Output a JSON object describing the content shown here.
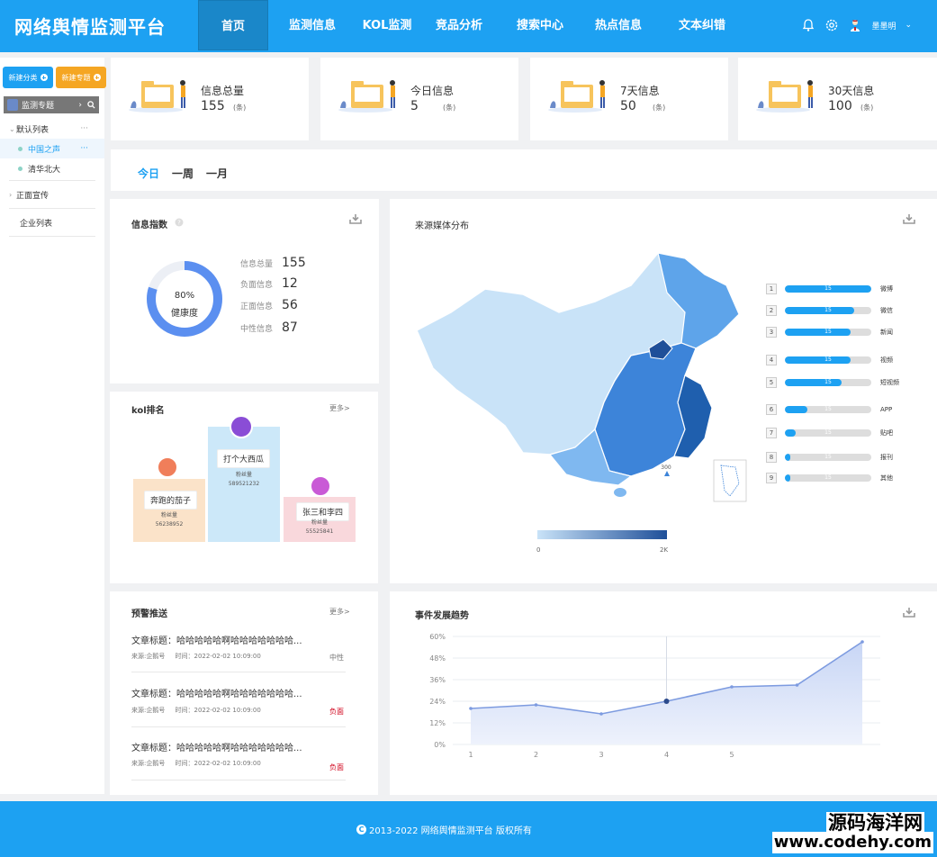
{
  "header": {
    "title": "网络舆情监测平台",
    "nav": [
      "首页",
      "监测信息",
      "KOL监测",
      "竞品分析",
      "搜索中心",
      "热点信息",
      "文本纠错"
    ],
    "active_nav": 0,
    "username": "墨墨明"
  },
  "sidebar": {
    "new_category": "新建分类",
    "new_topic": "新建专题",
    "topic_label": "监测专题",
    "tree": {
      "default_list": "默认列表",
      "item1": "中国之声",
      "item2": "清华北大",
      "positive": "正面宣传",
      "enterprise": "企业列表"
    }
  },
  "stats": [
    {
      "label": "信息总量",
      "value": "155",
      "unit": "(条)"
    },
    {
      "label": "今日信息",
      "value": "5",
      "unit": "(条)"
    },
    {
      "label": "7天信息",
      "value": "50",
      "unit": "(条)"
    },
    {
      "label": "30天信息",
      "value": "100",
      "unit": "(条)"
    }
  ],
  "period_tabs": [
    "今日",
    "一周",
    "一月"
  ],
  "info_index": {
    "title": "信息指数",
    "health_pct": "80%",
    "health_value": 0.8,
    "health_label": "健康度",
    "metrics": [
      {
        "label": "信息总量",
        "value": "155"
      },
      {
        "label": "负面信息",
        "value": "12"
      },
      {
        "label": "正面信息",
        "value": "56"
      },
      {
        "label": "中性信息",
        "value": "87"
      }
    ]
  },
  "kol": {
    "title": "kol排名",
    "more": "更多>",
    "items": [
      {
        "name": "奔跑的茄子",
        "sub_label": "粉丝量",
        "fans": "56238952"
      },
      {
        "name": "打个大西瓜",
        "sub_label": "粉丝量",
        "fans": "589521232"
      },
      {
        "name": "张三和李四",
        "sub_label": "粉丝量",
        "fans": "55525841"
      }
    ]
  },
  "alerts": {
    "title": "预警推送",
    "more": "更多>",
    "items": [
      {
        "title": "文章标题：哈哈哈哈哈啊哈哈哈哈哈哈哈...",
        "source": "来源:企鹅号",
        "time": "时间：2022-02-02 10:09:00",
        "tag": "中性",
        "tag_color": "#777777"
      },
      {
        "title": "文章标题：哈哈哈哈哈啊哈哈哈哈哈哈哈...",
        "source": "来源:企鹅号",
        "time": "时间：2022-02-02 10:09:00",
        "tag": "负面",
        "tag_color": "#d0021b"
      },
      {
        "title": "文章标题：哈哈哈哈哈啊哈哈哈哈哈哈哈...",
        "source": "来源:企鹅号",
        "time": "时间：2022-02-02 10:09:00",
        "tag": "负面",
        "tag_color": "#d0021b"
      }
    ]
  },
  "media": {
    "title": "来源媒体分布",
    "map_marker": "300",
    "scale_min": "0",
    "scale_max": "2K",
    "ranking": [
      {
        "rank": "1",
        "label": "微博",
        "value": "15",
        "fill": 1.0
      },
      {
        "rank": "2",
        "label": "微信",
        "value": "15",
        "fill": 0.8
      },
      {
        "rank": "3",
        "label": "新闻",
        "value": "15",
        "fill": 0.76
      },
      {
        "rank": "4",
        "label": "视频",
        "value": "15",
        "fill": 0.76
      },
      {
        "rank": "5",
        "label": "短视频",
        "value": "15",
        "fill": 0.66
      },
      {
        "rank": "6",
        "label": "APP",
        "value": "15",
        "fill": 0.26
      },
      {
        "rank": "7",
        "label": "贴吧",
        "value": "15",
        "fill": 0.12
      },
      {
        "rank": "8",
        "label": "报刊",
        "value": "15",
        "fill": 0.06
      },
      {
        "rank": "9",
        "label": "其他",
        "value": "15",
        "fill": 0.06
      }
    ]
  },
  "chart_data": {
    "type": "area",
    "title": "事件发展趋势",
    "x": [
      "1",
      "2",
      "3",
      "4",
      "5",
      "",
      ""
    ],
    "values": [
      20,
      22,
      17,
      24,
      32,
      33,
      57
    ],
    "yticks": [
      "0%",
      "12%",
      "24%",
      "36%",
      "48%",
      "60%"
    ],
    "ylim": [
      0,
      60
    ],
    "grid": true
  },
  "footer": {
    "text": "2013-2022 网络舆情监测平台 版权所有",
    "copy_symbol": "C"
  },
  "watermark": {
    "line1": "源码海洋网",
    "line2": "www.codehy.com"
  },
  "colors": {
    "primary": "#1da1f2",
    "orange": "#f5a623",
    "negative": "#d0021b"
  }
}
